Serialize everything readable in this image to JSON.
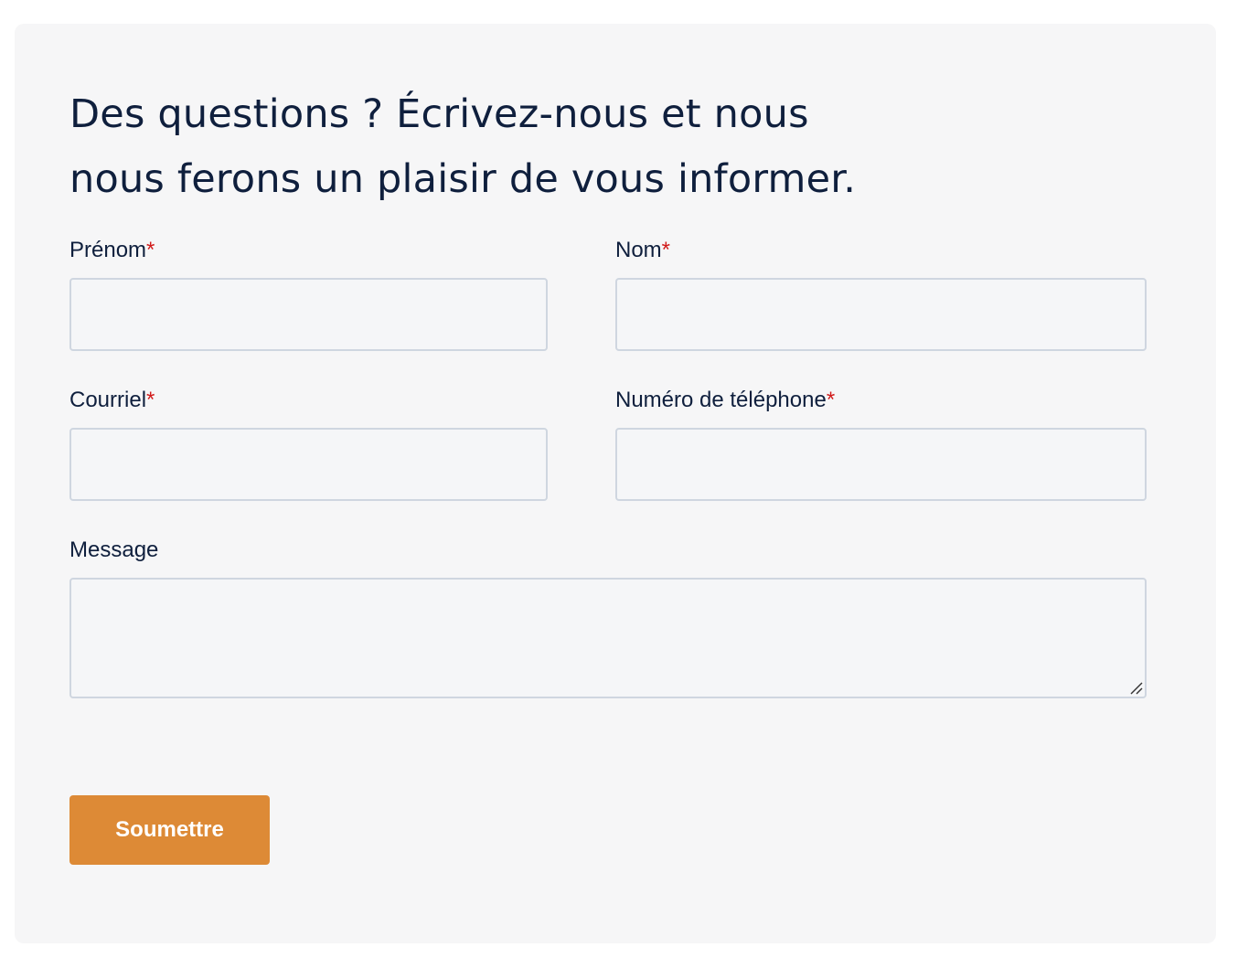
{
  "form": {
    "heading_line1": "Des questions ? Écrivez-nous et nous",
    "heading_line2": "nous ferons un plaisir de vous informer.",
    "required_marker": "*",
    "fields": {
      "first_name": {
        "label": "Prénom",
        "value": "",
        "required": true
      },
      "last_name": {
        "label": "Nom",
        "value": "",
        "required": true
      },
      "email": {
        "label": "Courriel",
        "value": "",
        "required": true
      },
      "phone": {
        "label": "Numéro de téléphone",
        "value": "",
        "required": true
      },
      "message": {
        "label": "Message",
        "value": "",
        "required": false
      }
    },
    "submit_label": "Soumettre"
  },
  "colors": {
    "card_background": "#f6f6f7",
    "text": "#0f1f3d",
    "required_marker": "#d11a1a",
    "input_border": "#cfd6e0",
    "submit_background": "#dd8a36",
    "submit_text": "#ffffff"
  },
  "icons": {
    "textarea_resize": "resize-handle-icon"
  }
}
